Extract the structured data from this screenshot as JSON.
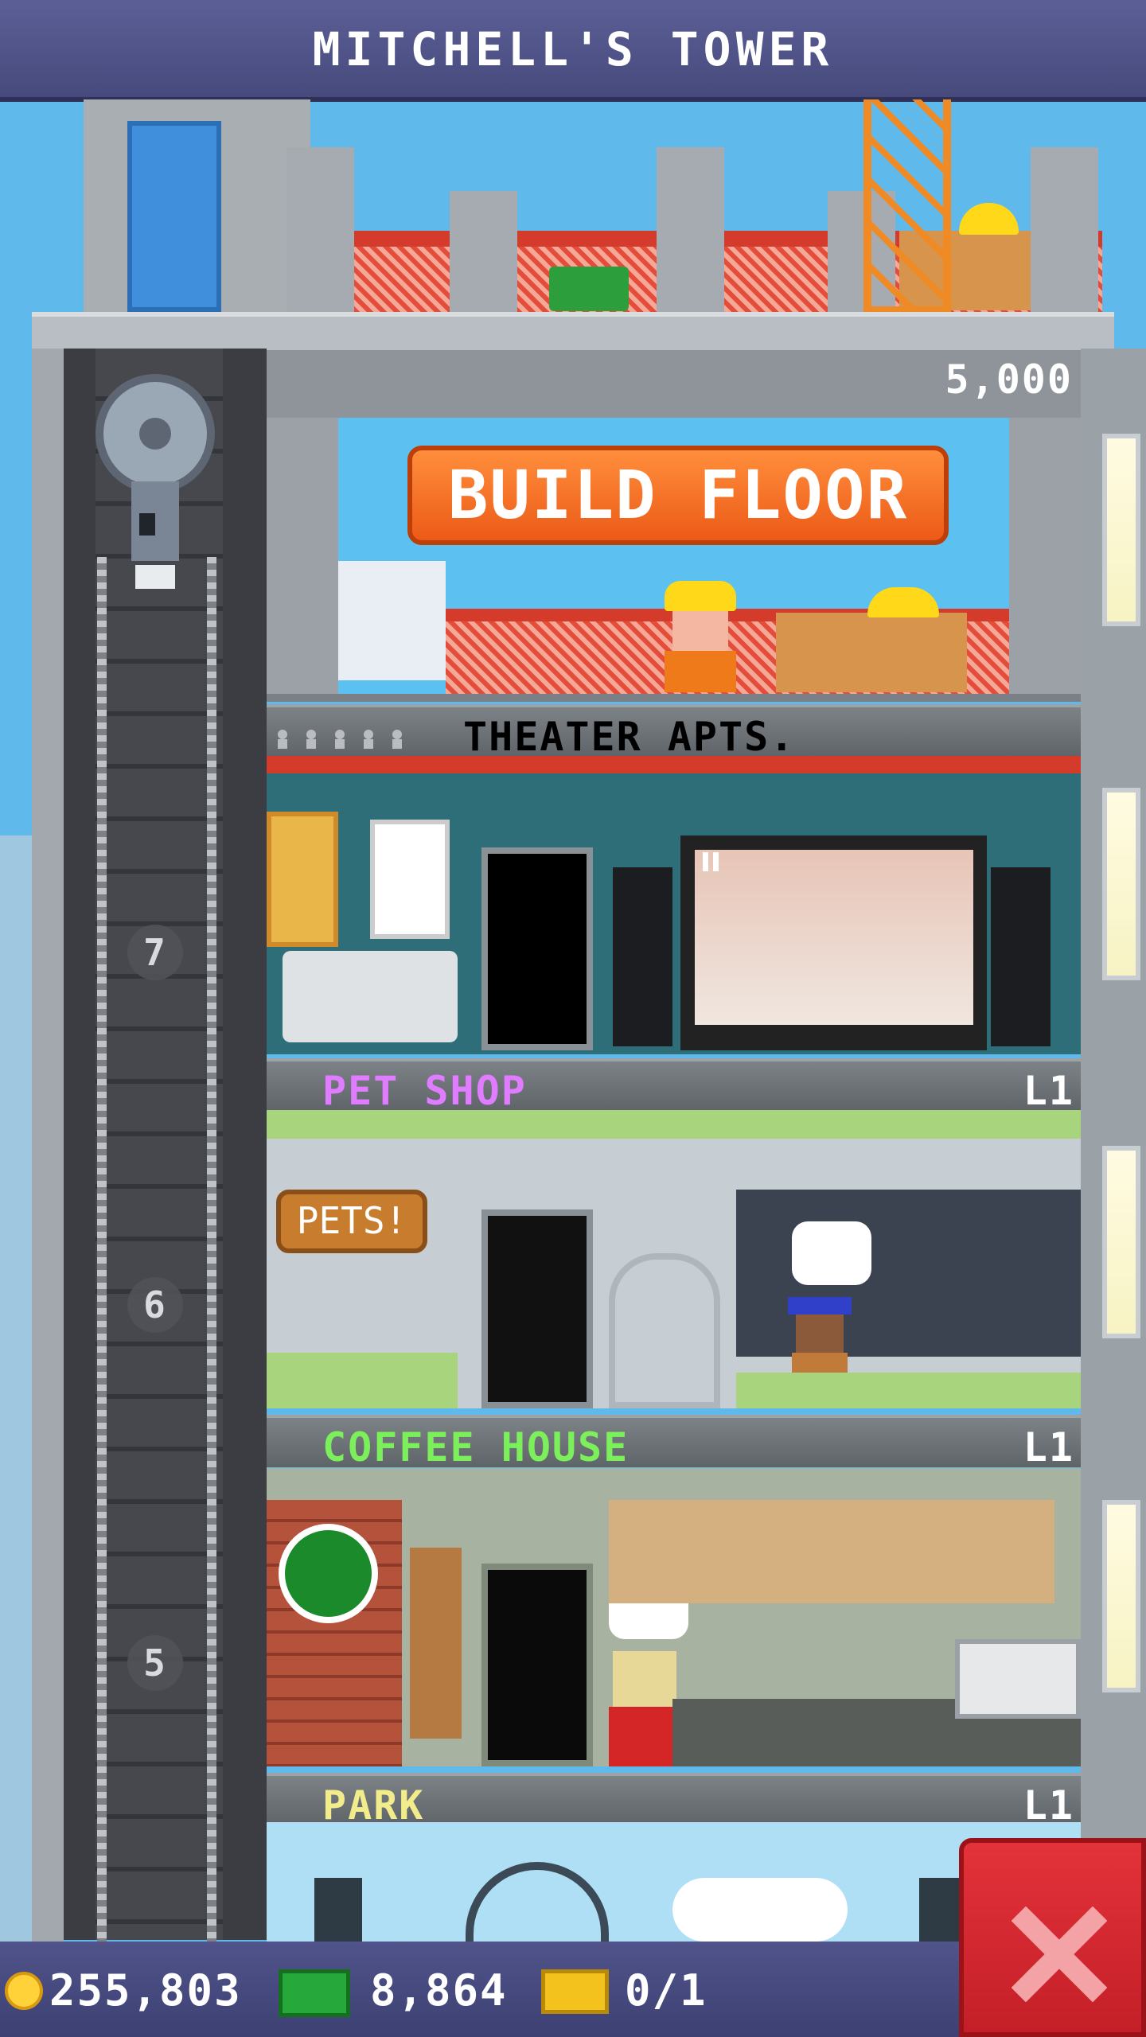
{
  "header": {
    "title": "MITCHELL'S TOWER"
  },
  "build_floor": {
    "label": "BUILD FLOOR",
    "cost": "5,000"
  },
  "floors": [
    {
      "name": "THEATER APTS.",
      "number": "7",
      "level": "",
      "label_color": "#ffffff"
    },
    {
      "name": "PET SHOP",
      "number": "6",
      "level": "L1",
      "label_color": "#e07cff"
    },
    {
      "name": "COFFEE HOUSE",
      "number": "5",
      "level": "L1",
      "label_color": "#7cf05a"
    },
    {
      "name": "PARK",
      "number": "",
      "level": "L1",
      "label_color": "#f2ec8a"
    }
  ],
  "signs": {
    "pets": "PETS!"
  },
  "status": {
    "coins": "255,803",
    "bux": "8,864",
    "tickets": "0/1"
  }
}
